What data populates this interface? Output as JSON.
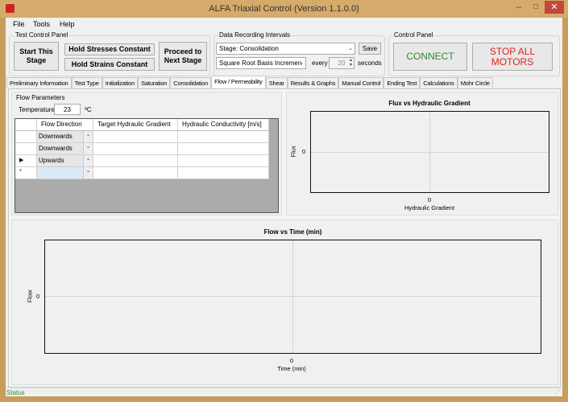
{
  "window": {
    "title": "ALFA Triaxial Control (Version 1.1.0.0)",
    "minimize": "–",
    "maximize": "□",
    "close": "✕"
  },
  "menu": [
    "File",
    "Tools",
    "Help"
  ],
  "test_control": {
    "title": "Test Control Panel",
    "start": "Start This Stage",
    "hold_stresses": "Hold Stresses Constant",
    "hold_strains": "Hold Strains Constant",
    "proceed": "Proceed to Next Stage"
  },
  "data_recording": {
    "title": "Data Recording Intervals",
    "stage": "Stage: Consolidation",
    "save": "Save",
    "basis": "Square Root Basis Incremen",
    "every": "every",
    "interval": "20",
    "seconds": "seconds"
  },
  "control_panel": {
    "title": "Control Panel",
    "connect": "CONNECT",
    "stop": "STOP ALL MOTORS",
    "connect_color": "#2e8b2e",
    "stop_color": "#e02020"
  },
  "tabs": [
    "Preliminary Information",
    "Test Type",
    "Initialization",
    "Saturation",
    "Consolidation",
    "Flow / Permeability",
    "Shear",
    "Results & Graphs",
    "Manual Control",
    "Ending Test",
    "Calculations",
    "Mohr Circle"
  ],
  "active_tab": "Flow / Permeability",
  "flow_params": {
    "title": "Flow Parameters",
    "temp_label": "Temperature:",
    "temp_value": "23",
    "temp_unit": "ºC",
    "columns": [
      "Flow Direction",
      "Target Hydraulic Gradient",
      "Hydraulic Conductivity [m/s]"
    ],
    "rows": [
      {
        "marker": "",
        "direction": "Downwards"
      },
      {
        "marker": "",
        "direction": "Downwards"
      },
      {
        "marker": "▶",
        "direction": "Upwards"
      },
      {
        "marker": "*",
        "direction": ""
      }
    ]
  },
  "chart_data": [
    {
      "type": "scatter",
      "title": "Flux vs Hydraulic Gradient",
      "xlabel": "Hydraulic Gradient",
      "ylabel": "Flux",
      "x_ticks": [
        "0"
      ],
      "y_ticks": [
        "0"
      ],
      "series": [],
      "grid": true
    },
    {
      "type": "line",
      "title": "Flow vs Time (min)",
      "xlabel": "Time (min)",
      "ylabel": "Flow",
      "x_ticks": [
        "0"
      ],
      "y_ticks": [
        "0"
      ],
      "series": [],
      "grid": true
    }
  ],
  "status": {
    "text": "Status",
    "color": "#2e8b2e"
  }
}
